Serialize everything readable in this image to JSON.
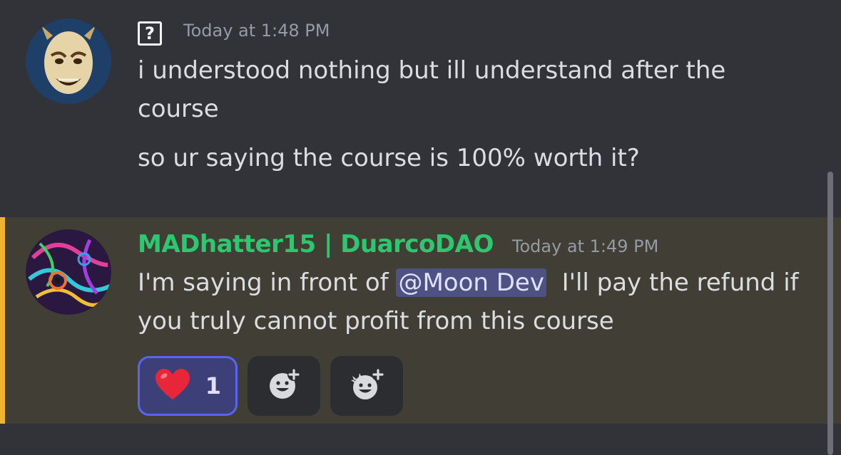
{
  "messages": [
    {
      "timestamp": "Today at 1:48 PM",
      "lines": [
        "i understood nothing but ill understand after the course",
        "so ur saying the course is 100% worth it?"
      ]
    },
    {
      "username": "MADhatter15 | DuarcoDAO",
      "timestamp": "Today at 1:49 PM",
      "text_before": "I'm saying in front of ",
      "mention": "@Moon Dev",
      "text_after": "  I'll pay the refund if you truly cannot profit from this course",
      "reactions": [
        {
          "emoji": "❤️",
          "count": "1",
          "icon": "heart-emoji"
        }
      ],
      "add_reaction_icons": [
        "add-reaction-icon",
        "add-super-reaction-icon"
      ]
    }
  ],
  "colors": {
    "background": "#313338",
    "mention_highlight": "#413e35",
    "mention_bar": "#f0b232",
    "username": "#2dc770"
  },
  "unknown_badge": "?"
}
